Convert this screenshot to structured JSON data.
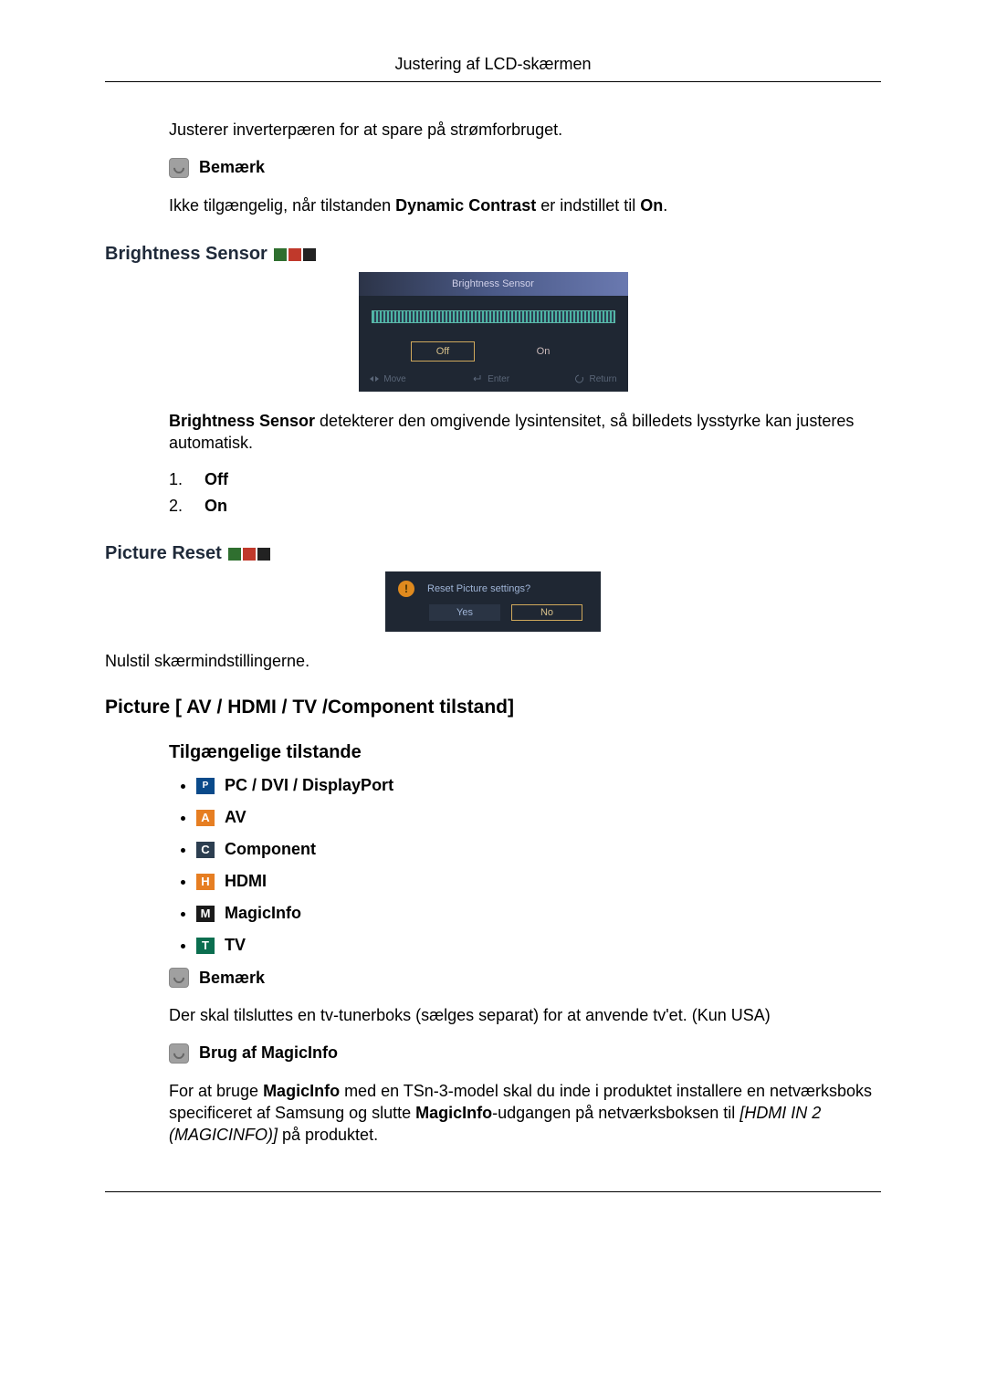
{
  "header": {
    "title": "Justering af LCD-skærmen"
  },
  "intro_para": "Justerer inverterpæren for at spare på strømforbruget.",
  "note_label": "Bemærk",
  "availability_sentence": {
    "prefix": "Ikke tilgængelig, når tilstanden ",
    "dc": "Dynamic Contrast",
    "mid": " er indstillet til ",
    "on": "On",
    "suffix": "."
  },
  "brightness_sensor": {
    "heading": "Brightness Sensor",
    "osd_title": "Brightness Sensor",
    "option_off": "Off",
    "option_on": "On",
    "footer_move": "Move",
    "footer_enter": "Enter",
    "footer_return": "Return",
    "desc_prefix_bold": "Brightness Sensor",
    "desc_rest": " detekterer den omgivende lysintensitet, så billedets lysstyrke kan justeres automatisk.",
    "list": [
      {
        "num": "1.",
        "label": "Off"
      },
      {
        "num": "2.",
        "label": "On"
      }
    ]
  },
  "picture_reset": {
    "heading": "Picture Reset",
    "osd_question": "Reset Picture settings?",
    "btn_yes": "Yes",
    "btn_no": "No",
    "desc": "Nulstil skærmindstillingerne."
  },
  "picture_modes": {
    "heading": "Picture [ AV / HDMI / TV /Component tilstand]",
    "subheading": "Tilgængelige tilstande",
    "items": [
      {
        "badge": "P",
        "cls": "pc",
        "label": "PC / DVI / DisplayPort"
      },
      {
        "badge": "A",
        "cls": "av",
        "label": "AV"
      },
      {
        "badge": "C",
        "cls": "comp",
        "label": "Component"
      },
      {
        "badge": "H",
        "cls": "hdmi",
        "label": "HDMI"
      },
      {
        "badge": "M",
        "cls": "magic",
        "label": "MagicInfo"
      },
      {
        "badge": "T",
        "cls": "tv",
        "label": "TV"
      }
    ]
  },
  "tv_note": "Der skal tilsluttes en tv-tunerboks (sælges separat) for at anvende tv'et. (Kun USA)",
  "magicinfo": {
    "heading": "Brug af MagicInfo",
    "p_prefix": "For at bruge ",
    "p_bold1": "MagicInfo",
    "p_mid1": " med en TSn-3-model skal du inde i produktet installere en netværksboks specificeret af Samsung og slutte ",
    "p_bold2": "MagicInfo",
    "p_mid2": "-udgangen på netværksboksen til ",
    "p_italic": "[HDMI IN 2 (MAGICINFO)]",
    "p_suffix": " på produktet."
  }
}
